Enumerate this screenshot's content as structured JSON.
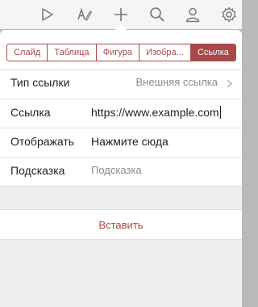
{
  "toolbar": {
    "icons": [
      "play-icon",
      "format-brush-icon",
      "plus-icon",
      "search-icon",
      "user-icon",
      "gear-icon"
    ]
  },
  "segments": [
    "Слайд",
    "Таблица",
    "Фигура",
    "Изобра...",
    "Ссылка"
  ],
  "active_segment": "Ссылка",
  "rows": {
    "link_type": {
      "label": "Тип ссылки",
      "value": "Внешняя ссылка"
    },
    "link": {
      "label": "Ссылка",
      "value": "https://www.example.com"
    },
    "display": {
      "label": "Отображать",
      "value": "Нажмите сюда"
    },
    "tooltip": {
      "label": "Подсказка",
      "placeholder": "Подсказка"
    }
  },
  "insert_label": "Вставить",
  "colors": {
    "accent": "#a8484a",
    "icon": "#777777"
  }
}
